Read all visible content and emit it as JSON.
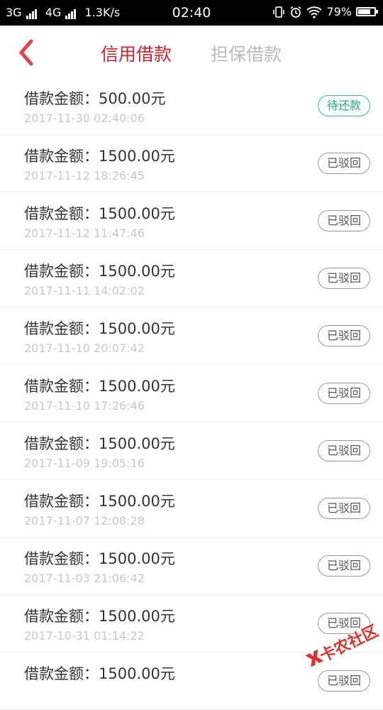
{
  "status_bar": {
    "network_1": "3G",
    "network_2": "4G",
    "speed": "1.3K/s",
    "time": "02:40",
    "battery": "79%",
    "battery_level": 0.79
  },
  "header": {
    "tabs": [
      {
        "label": "信用借款",
        "active": true
      },
      {
        "label": "担保借款",
        "active": false
      }
    ]
  },
  "loans": [
    {
      "amount": "借款金额：500.00元",
      "date": "2017-11-30 02:40:06",
      "status": "待还款"
    },
    {
      "amount": "借款金额：1500.00元",
      "date": "2017-11-12 18:26:45",
      "status": "已驳回"
    },
    {
      "amount": "借款金额：1500.00元",
      "date": "2017-11-12 11:47:46",
      "status": "已驳回"
    },
    {
      "amount": "借款金额：1500.00元",
      "date": "2017-11-11 14:02:02",
      "status": "已驳回"
    },
    {
      "amount": "借款金额：1500.00元",
      "date": "2017-11-10 20:07:42",
      "status": "已驳回"
    },
    {
      "amount": "借款金额：1500.00元",
      "date": "2017-11-10 17:26:46",
      "status": "已驳回"
    },
    {
      "amount": "借款金额：1500.00元",
      "date": "2017-11-09 19:05:16",
      "status": "已驳回"
    },
    {
      "amount": "借款金额：1500.00元",
      "date": "2017-11-07 12:08:28",
      "status": "已驳回"
    },
    {
      "amount": "借款金额：1500.00元",
      "date": "2017-11-03 21:06:42",
      "status": "已驳回"
    },
    {
      "amount": "借款金额：1500.00元",
      "date": "2017-10-31 01:14:22",
      "status": "已驳回"
    },
    {
      "amount": "借款金额：1500.00元",
      "date": "",
      "status": "已驳回"
    }
  ],
  "watermark": {
    "text": "卡农社区"
  },
  "colors": {
    "accent": "#c9272f",
    "pending": "#25a877",
    "inactive_tab": "#bbbbbb"
  }
}
